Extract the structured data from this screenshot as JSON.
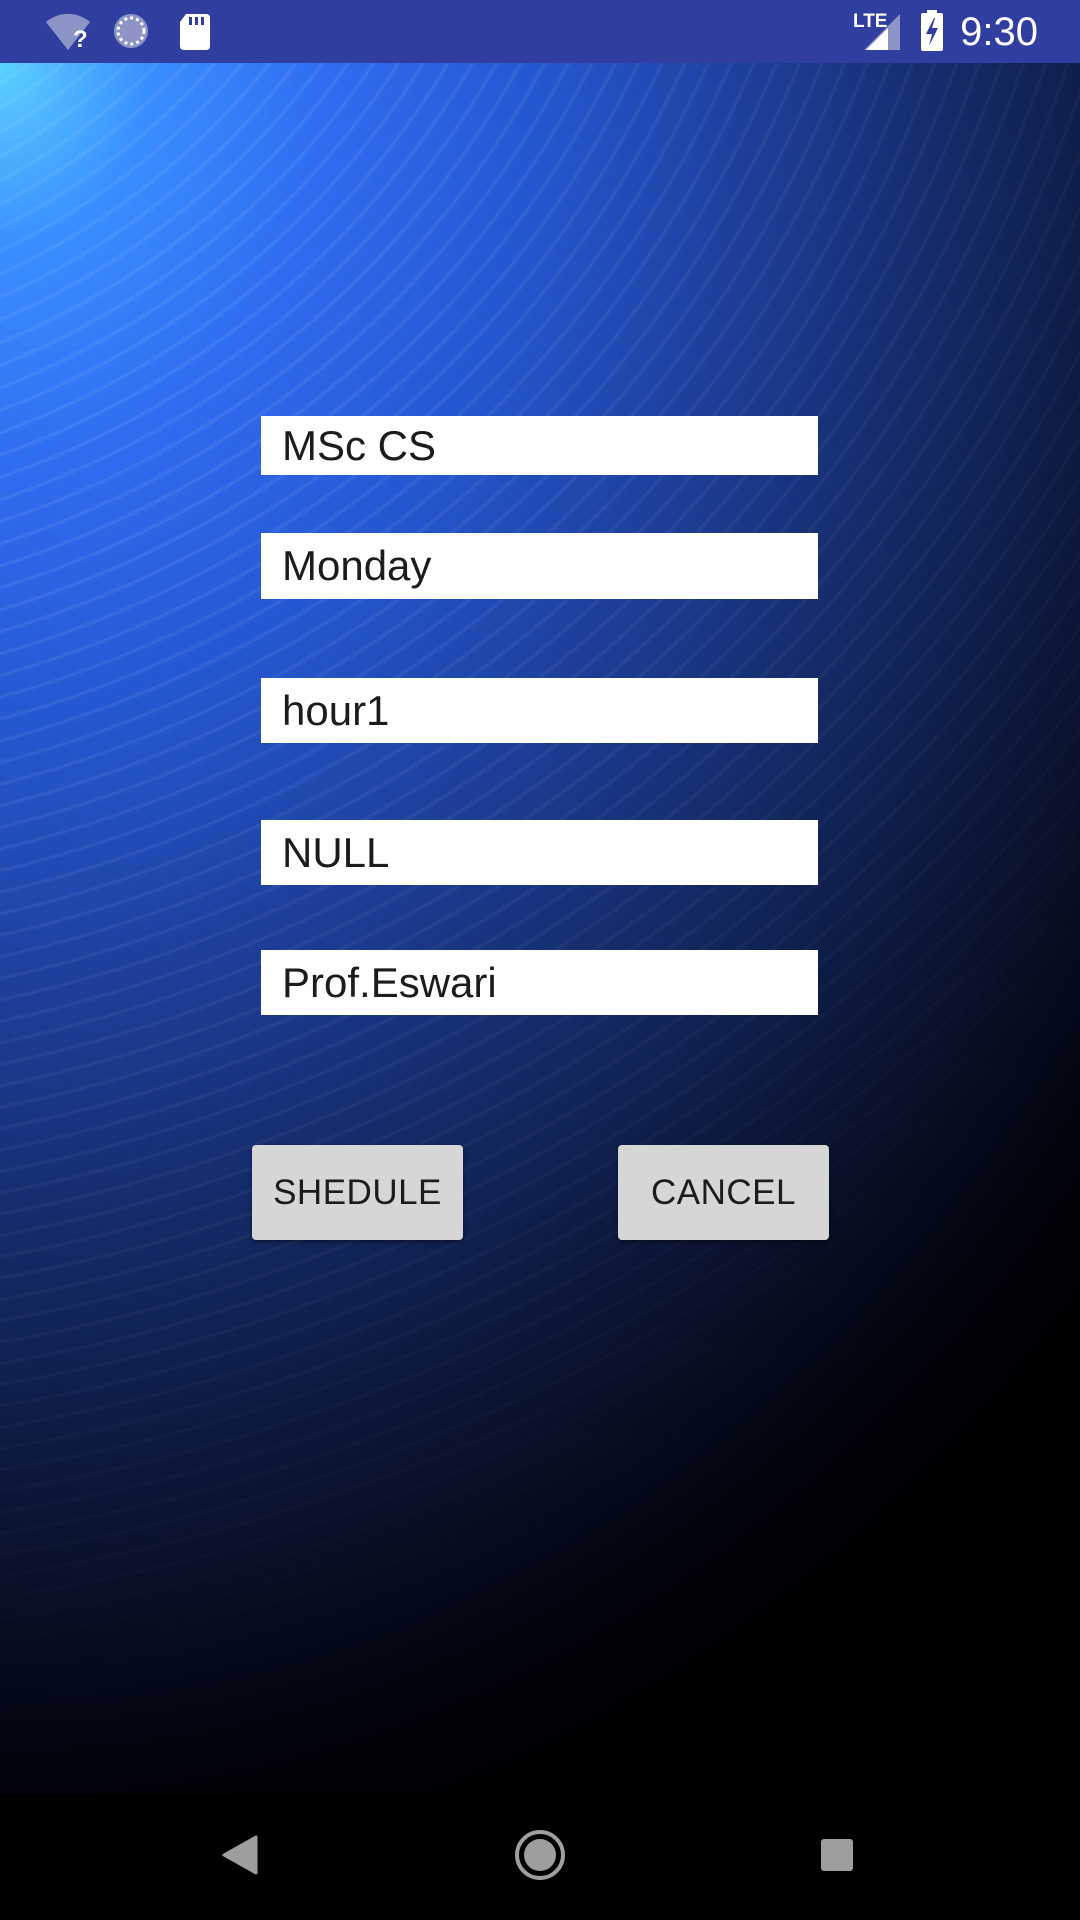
{
  "status_bar": {
    "time": "9:30",
    "network_label": "LTE",
    "icons": [
      "wifi-unknown-icon",
      "sync-icon",
      "sd-card-icon",
      "signal-icon",
      "battery-charging-icon"
    ]
  },
  "form": {
    "course": "MSc CS",
    "day": "Monday",
    "hour": "hour1",
    "subject": "NULL",
    "staff": "Prof.Eswari"
  },
  "buttons": {
    "schedule_label": "SHEDULE",
    "cancel_label": "CANCEL"
  },
  "nav_bar": {
    "icons": [
      "back-icon",
      "home-icon",
      "recents-icon"
    ]
  },
  "colors": {
    "status_bar": "#303f9f",
    "button_bg": "#d6d6d6",
    "field_bg": "#ffffff"
  }
}
